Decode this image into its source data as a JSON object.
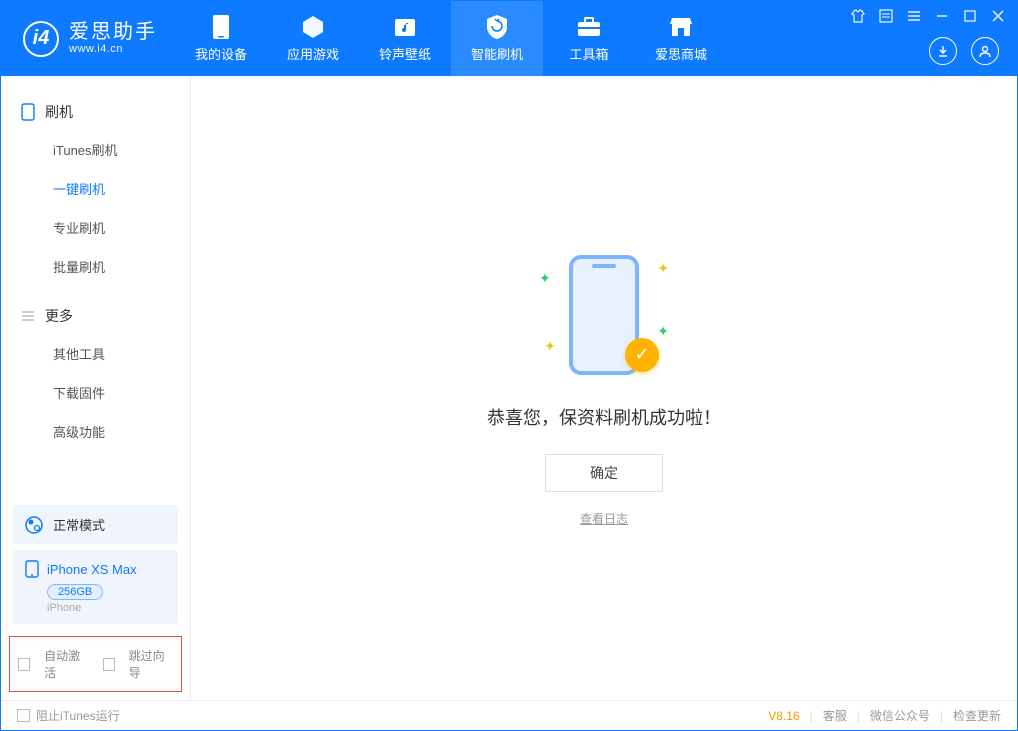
{
  "app": {
    "title": "爱思助手",
    "subtitle": "www.i4.cn"
  },
  "tabs": [
    {
      "label": "我的设备"
    },
    {
      "label": "应用游戏"
    },
    {
      "label": "铃声壁纸"
    },
    {
      "label": "智能刷机"
    },
    {
      "label": "工具箱"
    },
    {
      "label": "爱思商城"
    }
  ],
  "sidebar": {
    "section1": {
      "title": "刷机",
      "items": [
        "iTunes刷机",
        "一键刷机",
        "专业刷机",
        "批量刷机"
      ]
    },
    "section2": {
      "title": "更多",
      "items": [
        "其他工具",
        "下载固件",
        "高级功能"
      ]
    },
    "mode": "正常模式",
    "device": {
      "name": "iPhone XS Max",
      "capacity": "256GB",
      "type": "iPhone"
    },
    "check1": "自动激活",
    "check2": "跳过向导"
  },
  "main": {
    "success": "恭喜您，保资料刷机成功啦！",
    "ok": "确定",
    "log": "查看日志"
  },
  "footer": {
    "block_itunes": "阻止iTunes运行",
    "version": "V8.16",
    "links": [
      "客服",
      "微信公众号",
      "检查更新"
    ]
  }
}
